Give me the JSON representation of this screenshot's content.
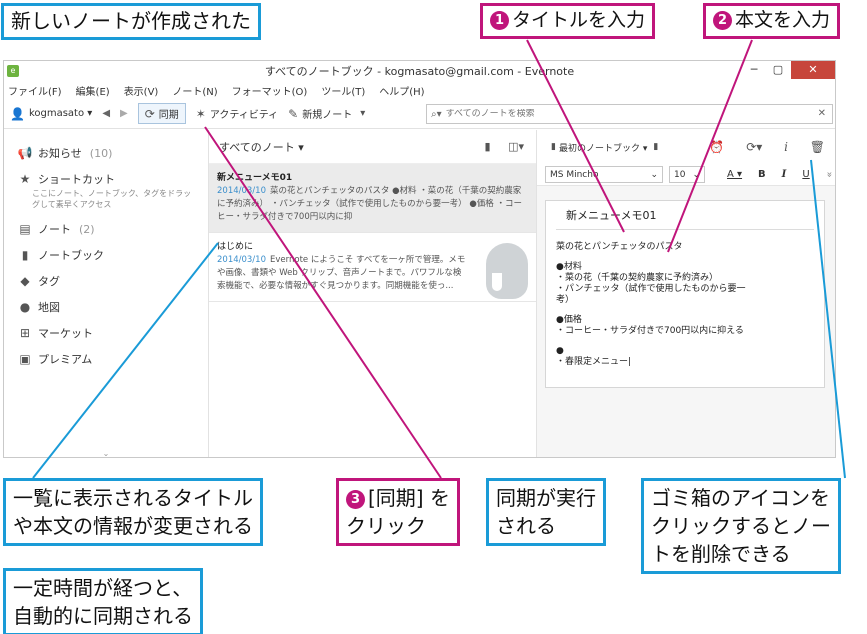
{
  "callouts": {
    "top_left": "新しいノートが作成された",
    "step1_num": "1",
    "step1": "タイトルを入力",
    "step2_num": "2",
    "step2": "本文を入力",
    "list_change_line1": "一覧に表示されるタイトル",
    "list_change_line2": "や本文の情報が変更される",
    "step3_num": "3",
    "step3_line1": "[同期] を",
    "step3_line2": "クリック",
    "sync_line1": "同期が実行",
    "sync_line2": "される",
    "trash_line1": "ゴミ箱のアイコンを",
    "trash_line2": "クリックするとノー",
    "trash_line3": "トを削除できる",
    "auto_line1": "一定時間が経つと、",
    "auto_line2": "自動的に同期される"
  },
  "window": {
    "title": "すべてのノートブック - kogmasato@gmail.com - Evernote",
    "min": "─",
    "max": "▢",
    "close": "✕"
  },
  "menu": [
    "ファイル(F)",
    "編集(E)",
    "表示(V)",
    "ノート(N)",
    "フォーマット(O)",
    "ツール(T)",
    "ヘルプ(H)"
  ],
  "toolbar": {
    "user": "kogmasato ▾",
    "back": "◀",
    "forward": "▶",
    "sync": "同期",
    "activity": "アクティビティ",
    "new_note": "新規ノート",
    "new_note_arrow": "▾",
    "search_placeholder": "すべてのノートを検索",
    "search_clear": "✕"
  },
  "sidebar": {
    "notifications": "お知らせ",
    "notifications_count": "(10)",
    "shortcuts": "ショートカット",
    "shortcuts_hint": "ここにノート、ノートブック、タグをドラッグして素早くアクセス",
    "notes": "ノート",
    "notes_count": "(2)",
    "notebooks": "ノートブック",
    "tags": "タグ",
    "atlas": "地図",
    "market": "マーケット",
    "premium": "プレミアム",
    "scroll": "⌄"
  },
  "notelist": {
    "header": "すべてのノート ▾",
    "notes": [
      {
        "title": "新メニューメモ01",
        "date": "2014/03/10",
        "snippet": "菜の花とパンチェッタのパスタ ●材料 ・菜の花（千葉の契約農家に予約済み） ・パンチェッタ（試作で使用したものから要一考） ●価格 ・コーヒー・サラダ付きで700円以内に抑"
      },
      {
        "title": "はじめに",
        "date": "2014/03/10",
        "snippet": "Evernote にようこそ すべてを一ヶ所で管理。メモや画像、書類や Web クリップ、音声ノートまで。パワフルな検索機能で、必要な情報がすぐ見つかります。同期機能を使っ..."
      }
    ]
  },
  "editor": {
    "notebook": "最初のノートブック ▾",
    "font": "MS Mincho",
    "size": "10",
    "font_color": "A ▾",
    "bold": "B",
    "italic": "I",
    "underline": "U",
    "more": "»",
    "note_title": "新メニューメモ01",
    "lines": [
      "菜の花とパンチェッタのパスタ",
      "",
      "●材料",
      "・菜の花（千葉の契約農家に予約済み）",
      "・パンチェッタ（試作で使用したものから要一",
      "考）",
      "",
      "●価格",
      "・コーヒー・サラダ付きで700円以内に抑える",
      "",
      "●",
      "・春限定メニュー|"
    ]
  },
  "colors": {
    "callout_blue": "#1a9bd7",
    "callout_pink": "#c0157b",
    "link_date": "#3b8fcc"
  }
}
